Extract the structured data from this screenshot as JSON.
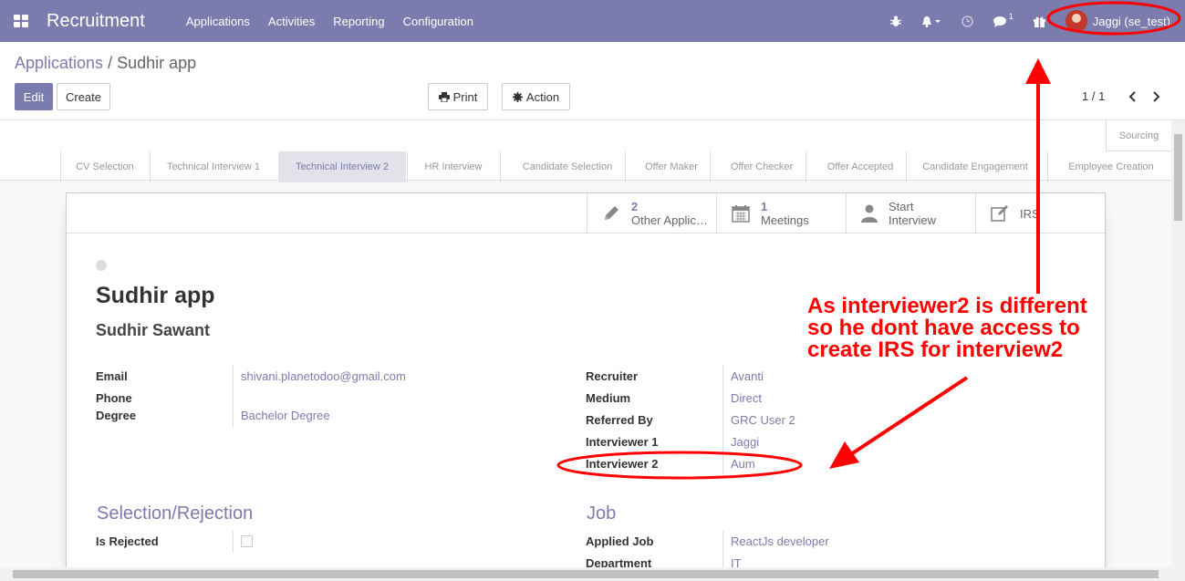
{
  "navbar": {
    "brand": "Recruitment",
    "menu": [
      "Applications",
      "Activities",
      "Reporting",
      "Configuration"
    ],
    "chat_count": "1",
    "user_name": "Jaggi (se_test)"
  },
  "breadcrumb": {
    "parent": "Applications",
    "separator": "/",
    "current": "Sudhir app"
  },
  "buttons": {
    "edit": "Edit",
    "create": "Create",
    "print": "Print",
    "action": "Action"
  },
  "pager": {
    "value": "1 / 1"
  },
  "stages": [
    "CV Selection",
    "Technical Interview 1",
    "Technical Interview 2",
    "HR Interview",
    "Candidate Selection",
    "Offer Maker",
    "Offer Checker",
    "Offer Accepted",
    "Candidate Engagement",
    "Employee Creation"
  ],
  "active_stage": "Technical Interview 2",
  "sourcing": "Sourcing",
  "smart_buttons": {
    "other_apps_count": "2",
    "other_apps_label": "Other Applic…",
    "meetings_count": "1",
    "meetings_label": "Meetings",
    "start_line1": "Start",
    "start_line2": "Interview",
    "irs_label": "IRS"
  },
  "record": {
    "title": "Sudhir app",
    "partner": "Sudhir Sawant",
    "email_label": "Email",
    "email": "shivani.planetodoo@gmail.com",
    "phone_label": "Phone",
    "phone": "",
    "degree_label": "Degree",
    "degree": "Bachelor Degree",
    "recruiter_label": "Recruiter",
    "recruiter": "Avanti",
    "medium_label": "Medium",
    "medium": "Direct",
    "referred_label": "Referred By",
    "referred": "GRC User 2",
    "int1_label": "Interviewer 1",
    "int1": "Jaggi",
    "int2_label": "Interviewer 2",
    "int2": "Aum",
    "sel_title": "Selection/Rejection",
    "rejected_label": "Is Rejected",
    "job_title": "Job",
    "applied_label": "Applied Job",
    "applied": "ReactJs developer",
    "dept_label": "Department",
    "dept": "IT"
  },
  "annotation": {
    "line1": "As interviewer2 is different",
    "line2": "so he dont have access to",
    "line3": "create IRS for interview2"
  },
  "colors": {
    "brand": "#7c7bad",
    "annotation": "#ff0000"
  }
}
